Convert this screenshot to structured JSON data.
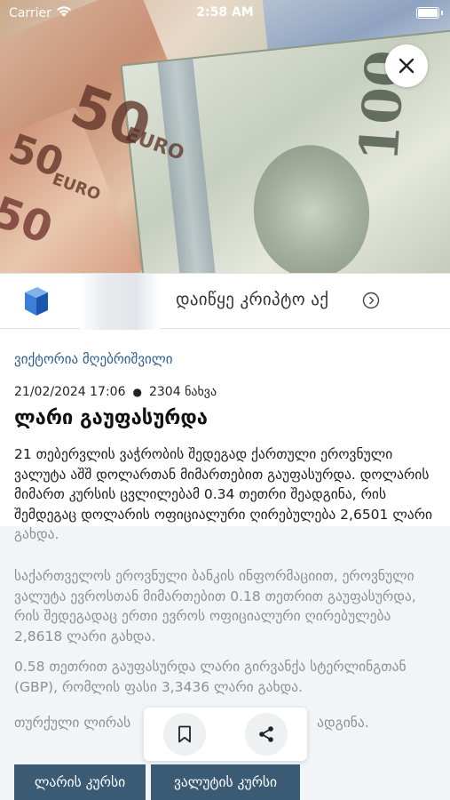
{
  "status_bar": {
    "carrier": "Carrier",
    "time": "2:58 AM",
    "wifi_icon": "wifi-icon",
    "battery_icon": "battery-icon"
  },
  "hero": {
    "image_icon": "currency-photo",
    "close_icon": "close-icon"
  },
  "ad": {
    "text": "დაიწყე კრიპტო აქ",
    "arrow_icon": "chevron-right-circle-icon",
    "logo_icon": "cube-logo-icon"
  },
  "article": {
    "author": "ვიქტორია მღებრიშვილი",
    "date": "21/02/2024 17:06",
    "views": "2304 ნახვა",
    "title": "ლარი გაუფასურდა",
    "paragraph1": "21 თებერვლის ვაჭრობის შედეგად ქართული ეროვნული ვალუტა აშშ დოლართან მიმართებით გაუფასურდა. დოლარის მიმართ კურსის ცვლილებამ 0.34 თეთრი შეადგინა, რის შემდეგაც დოლარის ოფიციალური ღირებულება 2,6501 ლარი გახდა.",
    "paragraph2": "საქართველოს ეროვნული ბანკის ინფორმაციით, ეროვნული ვალუტა ევროსთან მიმართებით 0.18 თეთრით გაუფასურდა, რის შედეგადაც ერთი ევროს ოფიციალური ღირებულება 2,8618 ლარი გახდა.",
    "paragraph3": "0.58 თეთრით გაუფასურდა ლარი გირვანქა სტერლინგთან (GBP), რომლის ფასი 3,3436 ლარი გახდა.",
    "paragraph4_start": "თურქული ლირას",
    "paragraph4_end": "ადგინა."
  },
  "actions": {
    "bookmark_icon": "bookmark-icon",
    "share_icon": "share-icon"
  },
  "tabs": {
    "lari_rate": "ლარის კურსი",
    "currency_rate": "ვალუტის კურსი"
  },
  "colors": {
    "accent": "#3b5a74",
    "author_link": "#2b5f93"
  }
}
